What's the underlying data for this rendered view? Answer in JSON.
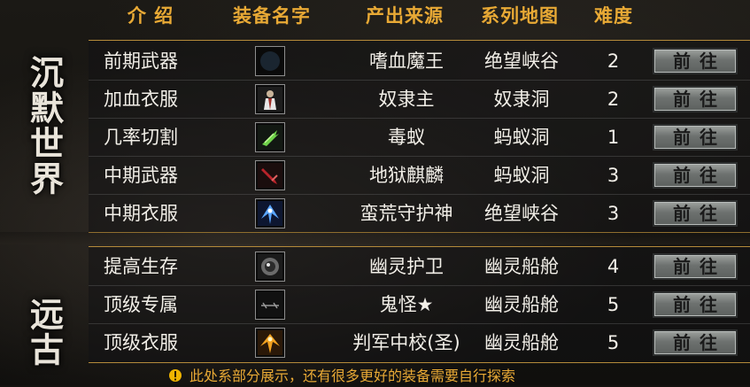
{
  "header": {
    "intro": "介 绍",
    "item_name": "装备名字",
    "source": "产出来源",
    "series_map": "系列地图",
    "difficulty": "难度"
  },
  "sections": [
    {
      "title": "沉默世界",
      "rows": [
        {
          "intro": "前期武器",
          "icon": "crescent-blade-icon",
          "source": "嗜血魔王",
          "map": "绝望峡谷",
          "difficulty": "2",
          "button": "前往"
        },
        {
          "intro": "加血衣服",
          "icon": "armored-figure-icon",
          "source": "奴隶主",
          "map": "奴隶洞",
          "difficulty": "2",
          "button": "前往"
        },
        {
          "intro": "几率切割",
          "icon": "green-claw-icon",
          "source": "毒蚁",
          "map": "蚂蚁洞",
          "difficulty": "1",
          "button": "前往"
        },
        {
          "intro": "中期武器",
          "icon": "red-blade-icon",
          "source": "地狱麒麟",
          "map": "蚂蚁洞",
          "difficulty": "3",
          "button": "前往"
        },
        {
          "intro": "中期衣服",
          "icon": "blue-winged-armor-icon",
          "source": "蛮荒守护神",
          "map": "绝望峡谷",
          "difficulty": "3",
          "button": "前往"
        }
      ]
    },
    {
      "title": "远古",
      "rows": [
        {
          "intro": "提高生存",
          "icon": "orb-guardian-icon",
          "source": "幽灵护卫",
          "map": "幽灵船舱",
          "difficulty": "4",
          "button": "前往"
        },
        {
          "intro": "顶级专属",
          "icon": "dark-weapon-icon",
          "source": "鬼怪★",
          "map": "幽灵船舱",
          "difficulty": "5",
          "button": "前往"
        },
        {
          "intro": "顶级衣服",
          "icon": "golden-winged-armor-icon",
          "source": "判军中校(圣)",
          "map": "幽灵船舱",
          "difficulty": "5",
          "button": "前往"
        }
      ]
    }
  ],
  "footer": {
    "icon": "warning-icon",
    "text": "此处系部分展示，还有很多更好的装备需要自行探索"
  },
  "colors": {
    "header_gold": "#e8a935",
    "divider_gold": "#b48a3a",
    "text": "#f2efe8"
  }
}
